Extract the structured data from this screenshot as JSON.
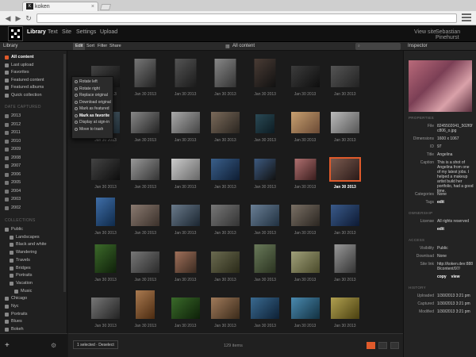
{
  "browser": {
    "tab_title": "koken",
    "favicon_text": "K",
    "url": ""
  },
  "topnav": {
    "items": [
      "Library",
      "Text",
      "Site",
      "Settings",
      "Upload"
    ],
    "right": [
      "View site",
      "Sebastian Pinehurst"
    ]
  },
  "subbar": {
    "library_label": "Library",
    "tools": [
      "Edit",
      "Sort",
      "Filter",
      "Share"
    ],
    "content_label": "All content",
    "inspector_label": "Inspector"
  },
  "sidebar": {
    "library_items": [
      "All content",
      "Last upload",
      "Favorites",
      "Featured content",
      "Featured albums",
      "Quick collection"
    ],
    "date_heading": "DATE CAPTURED",
    "years": [
      "2013",
      "2012",
      "2011",
      "2010",
      "2009",
      "2008",
      "2007",
      "2006",
      "2005",
      "2004",
      "2003",
      "2002"
    ],
    "collections_heading": "COLLECTIONS",
    "collections": [
      "Public",
      "Landscapes",
      "Black and white",
      "Wandering",
      "Travels",
      "Bridges",
      "Portraits",
      "Vacation",
      "Music",
      "Chicago",
      "Nyc",
      "Portraits",
      "Blues",
      "Bokeh",
      "Night",
      "Demo",
      "EXIF",
      "Architecture"
    ],
    "trash": "Trash"
  },
  "dropdown": {
    "items": [
      "Rotate left",
      "Rotate right",
      "Replace original",
      "Download original",
      "Mark as featured",
      "Mark as favorite",
      "Display at sign-in",
      "Move to trash"
    ]
  },
  "grid": {
    "caption": "Jan 30 2013",
    "selected_index": 20,
    "thumbs": [
      {
        "c1": "#444",
        "c2": "#111",
        "w": 36,
        "h": 27
      },
      {
        "c1": "#777",
        "c2": "#222",
        "w": 27,
        "h": 36
      },
      {
        "c1": "#555",
        "c2": "#1a1a1a",
        "w": 27,
        "h": 36
      },
      {
        "c1": "#888",
        "c2": "#333",
        "w": 27,
        "h": 36
      },
      {
        "c1": "#4a3c35",
        "c2": "#111",
        "w": 27,
        "h": 36
      },
      {
        "c1": "#3c3c3c",
        "c2": "#0e0e0e",
        "w": 36,
        "h": 27
      },
      {
        "c1": "#555",
        "c2": "#222",
        "w": 36,
        "h": 27
      },
      {
        "c1": "#5a6d78",
        "c2": "#1d2a33",
        "w": 36,
        "h": 27
      },
      {
        "c1": "#888",
        "c2": "#222",
        "w": 36,
        "h": 27
      },
      {
        "c1": "#aaa",
        "c2": "#444",
        "w": 36,
        "h": 27
      },
      {
        "c1": "#7a6a5a",
        "c2": "#2a2520",
        "w": 36,
        "h": 27
      },
      {
        "c1": "#2a4a55",
        "c2": "#0d1b22",
        "w": 24,
        "h": 24
      },
      {
        "c1": "#c8a070",
        "c2": "#6a4a35",
        "w": 36,
        "h": 27
      },
      {
        "c1": "#bbb",
        "c2": "#555",
        "w": 36,
        "h": 27
      },
      {
        "c1": "#444",
        "c2": "#0d0d0d",
        "w": 36,
        "h": 27
      },
      {
        "c1": "#999",
        "c2": "#333",
        "w": 36,
        "h": 27
      },
      {
        "c1": "#ccc",
        "c2": "#666",
        "w": 36,
        "h": 27
      },
      {
        "c1": "#3a5f8a",
        "c2": "#0e1d33",
        "w": 36,
        "h": 27
      },
      {
        "c1": "#3d5a80",
        "c2": "#111",
        "w": 27,
        "h": 27
      },
      {
        "c1": "#b07070",
        "c2": "#3a1d1d",
        "w": 27,
        "h": 27
      },
      {
        "c1": "#7a5a4f",
        "c2": "#2a1a18",
        "w": 36,
        "h": 27
      },
      {
        "c1": "#3f6ea8",
        "c2": "#0f2a4a",
        "w": 24,
        "h": 36
      },
      {
        "c1": "#8a7a70",
        "c2": "#3a302a",
        "w": 36,
        "h": 27
      },
      {
        "c1": "#6a7a8a",
        "c2": "#1a2530",
        "w": 36,
        "h": 27
      },
      {
        "c1": "#777",
        "c2": "#333",
        "w": 36,
        "h": 27
      },
      {
        "c1": "#6a7f95",
        "c2": "#203040",
        "w": 36,
        "h": 27
      },
      {
        "c1": "#7a7065",
        "c2": "#2a2520",
        "w": 36,
        "h": 27
      },
      {
        "c1": "#3a5a8a",
        "c2": "#0d1a33",
        "w": 36,
        "h": 27
      },
      {
        "c1": "#3c6a2a",
        "c2": "#0f200a",
        "w": 27,
        "h": 36
      },
      {
        "c1": "#777",
        "c2": "#2a2a2a",
        "w": 36,
        "h": 27
      },
      {
        "c1": "#a0705a",
        "c2": "#3a2a20",
        "w": 27,
        "h": 27
      },
      {
        "c1": "#6a6a50",
        "c2": "#2a2a18",
        "w": 36,
        "h": 27
      },
      {
        "c1": "#6a7a5a",
        "c2": "#2a3320",
        "w": 27,
        "h": 36
      },
      {
        "c1": "#a0a07a",
        "c2": "#4a4a2a",
        "w": 36,
        "h": 27
      },
      {
        "c1": "#999",
        "c2": "#333",
        "w": 27,
        "h": 36
      },
      {
        "c1": "#777",
        "c2": "#222",
        "w": 36,
        "h": 27
      },
      {
        "c1": "#aa7a50",
        "c2": "#4a2a10",
        "w": 24,
        "h": 36
      },
      {
        "c1": "#3a6a2a",
        "c2": "#0d2008",
        "w": 36,
        "h": 27
      },
      {
        "c1": "#a07a5a",
        "c2": "#3a2a1a",
        "w": 36,
        "h": 27
      },
      {
        "c1": "#3a6a90",
        "c2": "#0d2035",
        "w": 36,
        "h": 27
      },
      {
        "c1": "#4a8ab0",
        "c2": "#123040",
        "w": 36,
        "h": 27
      },
      {
        "c1": "#b0a050",
        "c2": "#4a4010",
        "w": 36,
        "h": 27
      }
    ]
  },
  "bottombar": {
    "selected": "1 selected",
    "deselect": "Deselect",
    "count": "129 items"
  },
  "inspector": {
    "properties_heading": "PROPERTIES",
    "rows": [
      {
        "k": "File",
        "v": "8245502041_502f0fc806_o.jpg"
      },
      {
        "k": "Dimensions",
        "v": "1600 x 1067"
      },
      {
        "k": "ID",
        "v": "97"
      },
      {
        "k": "Title",
        "v": "Angelina"
      },
      {
        "k": "Caption",
        "v": "This is a shot of Angelina from one of my latest jobs. I helped a makeup artist build her portfolio, had a good time."
      }
    ],
    "categories_label": "Categories",
    "categories_value": "None",
    "tags_label": "Tags",
    "edit": "edit",
    "ownership_heading": "OWNERSHIP",
    "license_label": "License",
    "license_value": "All rights reserved",
    "access_heading": "ACCESS",
    "visibility_label": "Visibility",
    "visibility_value": "Public",
    "download_label": "Download",
    "download_value": "None",
    "sitelink_label": "Site link",
    "sitelink_value": "http://koken.dev:8888/content/97/",
    "copy": "copy",
    "view": "view",
    "history_heading": "HISTORY",
    "uploaded_label": "Uploaded",
    "uploaded_value": "1/30/2013 3:21 pm",
    "captured_label": "Captured",
    "captured_value": "1/30/2013 3:21 pm",
    "modified_label": "Modified",
    "modified_value": "1/30/2013 3:21 pm"
  },
  "colors": {
    "accent": "#e05a2b"
  }
}
